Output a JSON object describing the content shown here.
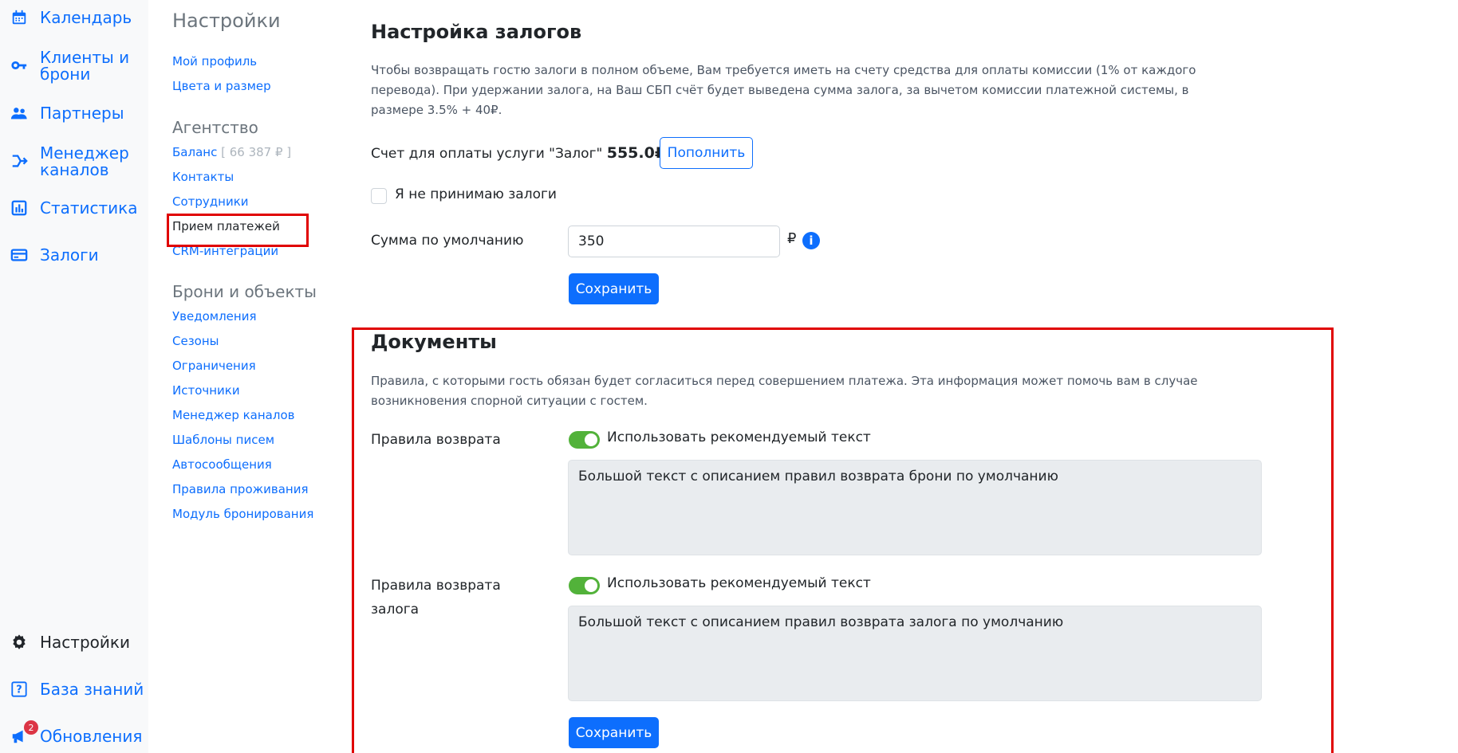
{
  "nav": {
    "calendar": "Календарь",
    "clients": "Клиенты и брони",
    "partners": "Партнеры",
    "channel_manager": "Менеджер каналов",
    "statistics": "Статистика",
    "deposits": "Залоги",
    "settings": "Настройки",
    "knowledge": "База знаний",
    "updates": "Обновления",
    "updates_badge": "2"
  },
  "submenu": {
    "title": "Настройки",
    "profile_group": [
      "Мой профиль",
      "Цвета и размер"
    ],
    "agency_title": "Агентство",
    "balance_label": "Баланс",
    "balance_value": "[ 66 387 ₽ ]",
    "agency_links": [
      "Контакты",
      "Сотрудники",
      "Прием платежей",
      "CRM-интеграции"
    ],
    "bookings_title": "Брони и объекты",
    "bookings_links": [
      "Уведомления",
      "Сезоны",
      "Ограничения",
      "Источники",
      "Менеджер каналов",
      "Шаблоны писем",
      "Автосообщения",
      "Правила проживания",
      "Модуль бронирования"
    ]
  },
  "deposits": {
    "title": "Настройка залогов",
    "description": "Чтобы возвращать гостю залоги в полном объеме, Вам требуется иметь на счету средства для оплаты комиссии (1% от каждого перевода). При удержании залога, на Ваш СБП счёт будет выведена сумма залога, за вычетом комиссии платежной системы, в размере 3.5% + 40₽.",
    "account_label": "Счет для оплаты услуги \"Залог\"",
    "account_value": "555.0₽",
    "topup_button": "Пополнить",
    "no_deposits_label": "Я не принимаю залоги",
    "default_sum_label": "Сумма по умолчанию",
    "default_sum_value": "350",
    "currency": "₽",
    "info": "i",
    "save_button": "Сохранить"
  },
  "documents": {
    "title": "Документы",
    "description": "Правила, с которыми гость обязан будет согласиться перед совершением платежа. Эта информация может помочь вам в случае возникновения спорной ситуации с гостем.",
    "refund_rules_label": "Правила возврата",
    "use_recommended_1": "Использовать рекомендуемый текст",
    "refund_rules_text": "Большой текст с описанием правил возврата брони по умолчанию",
    "deposit_rules_label_1": "Правила возврата",
    "deposit_rules_label_2": "залога",
    "use_recommended_2": "Использовать рекомендуемый текст",
    "deposit_rules_text": "Большой текст с описанием правил возврата залога по умолчанию",
    "save_button": "Сохранить"
  }
}
